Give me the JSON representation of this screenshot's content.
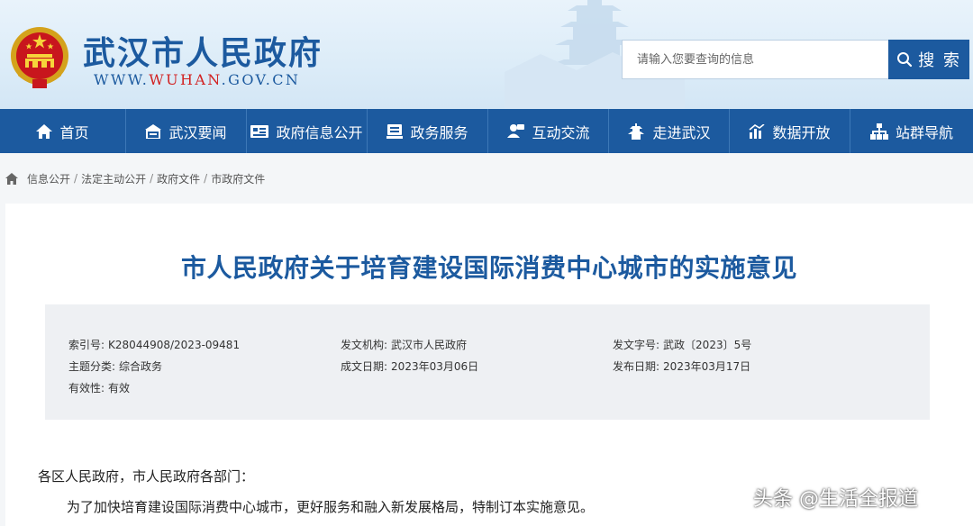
{
  "header": {
    "site_name": "武汉市人民政府",
    "url_prefix": "WWW.",
    "url_brand": "WUHAN",
    "url_suffix": ".GOV.CN",
    "search": {
      "placeholder": "请输入您要查询的信息",
      "button_label": "搜 索"
    }
  },
  "nav": {
    "items": [
      {
        "label": "首页",
        "icon": "home-icon"
      },
      {
        "label": "武汉要闻",
        "icon": "news-icon"
      },
      {
        "label": "政府信息公开",
        "icon": "info-disclosure-icon"
      },
      {
        "label": "政务服务",
        "icon": "service-icon"
      },
      {
        "label": "互动交流",
        "icon": "interaction-icon"
      },
      {
        "label": "走进武汉",
        "icon": "tower-icon"
      },
      {
        "label": "数据开放",
        "icon": "data-chart-icon"
      },
      {
        "label": "站群导航",
        "icon": "site-network-icon"
      }
    ]
  },
  "breadcrumb": {
    "items": [
      "信息公开",
      "法定主动公开",
      "政府文件",
      "市政府文件"
    ],
    "separator": "/"
  },
  "document": {
    "title": "市人民政府关于培育建设国际消费中心城市的实施意见",
    "meta": {
      "index_no": {
        "label": "索引号:",
        "value": "K28044908/2023-09481"
      },
      "issuer": {
        "label": "发文机构:",
        "value": "武汉市人民政府"
      },
      "doc_no": {
        "label": "发文字号:",
        "value": "武政〔2023〕5号"
      },
      "category": {
        "label": "主题分类:",
        "value": "综合政务"
      },
      "created_date": {
        "label": "成文日期:",
        "value": "2023年03月06日"
      },
      "publish_date": {
        "label": "发布日期:",
        "value": "2023年03月17日"
      },
      "validity": {
        "label": "有效性:",
        "value": "有效"
      }
    },
    "salutation": "各区人民政府，市人民政府各部门：",
    "paragraph_1": "为了加快培育建设国际消费中心城市，更好服务和融入新发展格局，特制订本实施意见。"
  },
  "watermark": "头条 @生活全报道",
  "colors": {
    "brand_blue": "#1c5a9f",
    "url_red": "#d22222",
    "meta_bg": "#eef0f3"
  }
}
